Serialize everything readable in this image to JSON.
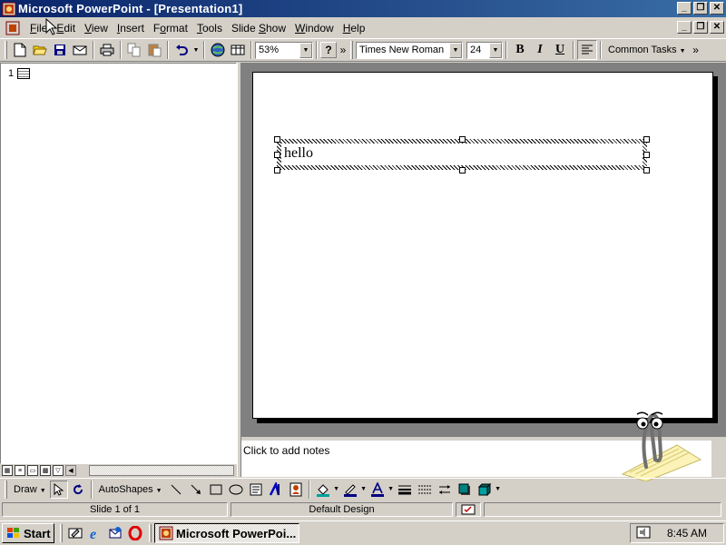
{
  "window": {
    "title": "Microsoft PowerPoint - [Presentation1]",
    "caption_min": "_",
    "caption_restore": "❐",
    "caption_close": "✕"
  },
  "menu": {
    "items": [
      "File",
      "Edit",
      "View",
      "Insert",
      "Format",
      "Tools",
      "Slide Show",
      "Window",
      "Help"
    ],
    "underline_index": [
      0,
      0,
      0,
      0,
      1,
      0,
      6,
      0,
      0
    ]
  },
  "toolbar": {
    "zoom": "53%",
    "font_name": "Times New Roman",
    "font_size": "24",
    "bold": "B",
    "italic": "I",
    "underline": "U",
    "common_tasks": "Common Tasks",
    "overflow": "»",
    "help": "?"
  },
  "outline": {
    "slide_number": "1"
  },
  "slide": {
    "text": "hello"
  },
  "notes": {
    "placeholder": "Click to add notes"
  },
  "drawing": {
    "draw": "Draw",
    "autoshapes": "AutoShapes"
  },
  "status": {
    "slide": "Slide 1 of 1",
    "design": "Default Design"
  },
  "taskbar": {
    "start": "Start",
    "task": "Microsoft PowerPoi...",
    "clock": "8:45 AM"
  },
  "icons": [
    "powerpoint-icon",
    "new-icon",
    "open-icon",
    "save-icon",
    "email-icon",
    "print-icon",
    "copy-icon",
    "paste-icon",
    "undo-icon",
    "web-icon",
    "table-icon",
    "help-icon",
    "align-icon",
    "select-icon",
    "rotate-icon",
    "line-icon",
    "arrow-icon",
    "rectangle-icon",
    "oval-icon",
    "textbox-icon",
    "wordart-icon",
    "clipart-icon",
    "fill-color-icon",
    "line-color-icon",
    "font-color-icon",
    "line-style-icon",
    "dash-style-icon",
    "arrow-style-icon",
    "shadow-icon",
    "3d-icon",
    "windows-logo-icon",
    "desktop-icon",
    "ie-icon",
    "outlook-icon",
    "opera-icon",
    "volume-icon",
    "clippy-icon"
  ]
}
